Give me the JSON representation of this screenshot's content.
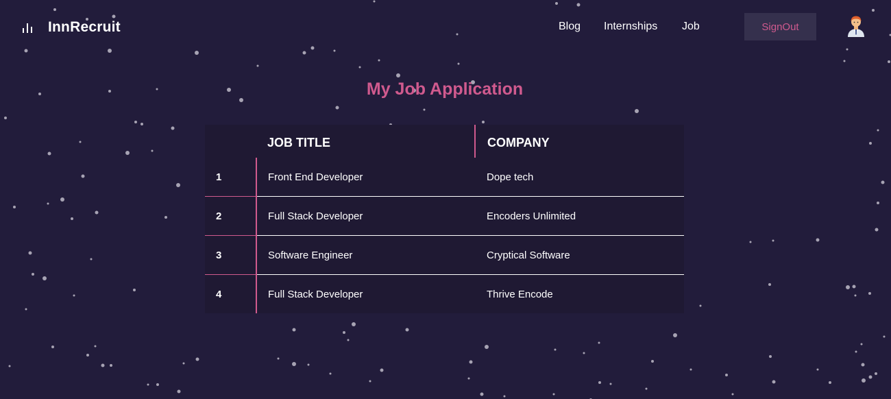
{
  "brand": {
    "name": "InnRecruit",
    "logo_icon": "bar-chart-icon"
  },
  "nav": {
    "links": [
      "Blog",
      "Internships",
      "Job"
    ],
    "signout_label": "SignOut",
    "avatar_icon": "user-avatar-icon"
  },
  "page": {
    "title": "My Job Application"
  },
  "table": {
    "headers": {
      "job_title": "JOB TITLE",
      "company": "COMPANY"
    },
    "rows": [
      {
        "num": "1",
        "title": "Front End Developer",
        "company": "Dope tech"
      },
      {
        "num": "2",
        "title": "Full Stack Developer",
        "company": "Encoders Unlimited"
      },
      {
        "num": "3",
        "title": "Software Engineer",
        "company": "Cryptical Software"
      },
      {
        "num": "4",
        "title": "Full Stack Developer",
        "company": "Thrive Encode"
      }
    ]
  },
  "colors": {
    "background": "#221c3b",
    "accent": "#d05a8e",
    "table_bg": "#1f1933",
    "button_bg": "#35304d",
    "star": "#a7a3b3"
  }
}
